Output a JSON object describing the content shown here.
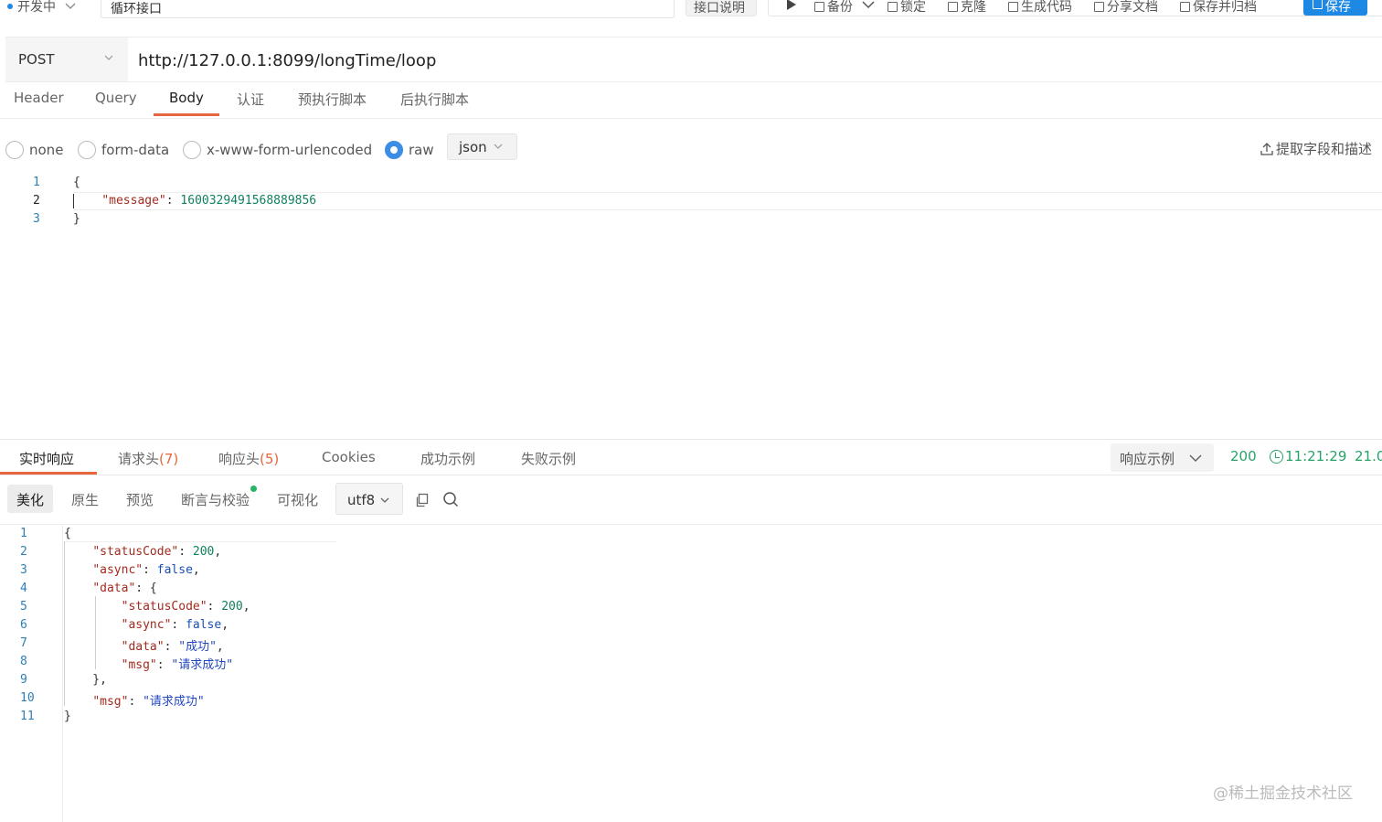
{
  "topbar": {
    "status": "开发中",
    "api_name": "循环接口",
    "doc_button": "接口说明",
    "tools": [
      "备份",
      "锁定",
      "克隆",
      "生成代码",
      "分享文档",
      "保存并归档"
    ],
    "save_button": "保存"
  },
  "request": {
    "method": "POST",
    "url": "http://127.0.0.1:8099/longTime/loop",
    "tabs": [
      "Header",
      "Query",
      "Body",
      "认证",
      "预执行脚本",
      "后执行脚本"
    ],
    "active_tab": "Body",
    "body_types": [
      "none",
      "form-data",
      "x-www-form-urlencoded",
      "raw"
    ],
    "selected_body_type": "raw",
    "raw_format": "json",
    "extract_button": "提取字段和描述",
    "body_lines": [
      "1",
      "2",
      "3"
    ],
    "body_message_key": "\"message\"",
    "body_message_value": "1600329491568889856",
    "open_brace": "{",
    "close_brace": "}"
  },
  "response": {
    "tabs": [
      "实时响应",
      "请求头",
      "响应头",
      "Cookies",
      "成功示例",
      "失败示例"
    ],
    "request_header_count": "(7)",
    "response_header_count": "(5)",
    "active_tab": "实时响应",
    "example_select": "响应示例",
    "status_code": "200",
    "time": "11:21:29",
    "size": "21.0",
    "view_tabs": [
      "美化",
      "原生",
      "预览",
      "断言与校验",
      "可视化"
    ],
    "active_view": "美化",
    "encoding": "utf8",
    "line_numbers": [
      "1",
      "2",
      "3",
      "4",
      "5",
      "6",
      "7",
      "8",
      "9",
      "10",
      "11"
    ],
    "body": {
      "statusCode_key": "\"statusCode\"",
      "statusCode": "200",
      "async_key": "\"async\"",
      "async": "false",
      "data_key": "\"data\"",
      "msg_key": "\"msg\"",
      "inner_data": "\"成功\"",
      "inner_msg": "\"请求成功\"",
      "msg": "\"请求成功\""
    }
  },
  "watermark": "@稀土掘金技术社区",
  "colors": {
    "accent": "#e8663d",
    "primary": "#1e88e5",
    "success": "#29a36a"
  }
}
